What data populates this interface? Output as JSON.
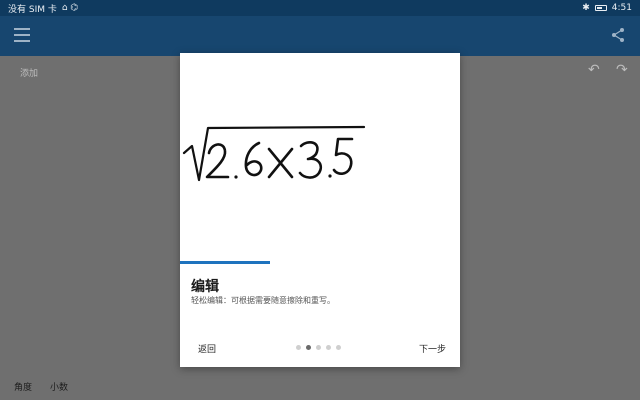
{
  "status_bar": {
    "carrier": "没有 SIM 卡",
    "carrier_icons": "⌂ ⌬",
    "bluetooth": "✱",
    "battery": "battery-icon",
    "time": "4:51"
  },
  "app_bar": {
    "menu_icon": "menu-icon",
    "share_icon": "share-icon"
  },
  "editor": {
    "hint": "添加"
  },
  "bottom_bar": {
    "angle": "角度",
    "decimal": "小数"
  },
  "dialog": {
    "handwriting": "√2.6×3.5",
    "title": "编辑",
    "description": "轻松编辑：可根据需要随意擦除和重写。",
    "back_label": "返回",
    "next_label": "下一步",
    "page_count": 5,
    "active_page": 2,
    "progress_fraction": 0.32
  }
}
